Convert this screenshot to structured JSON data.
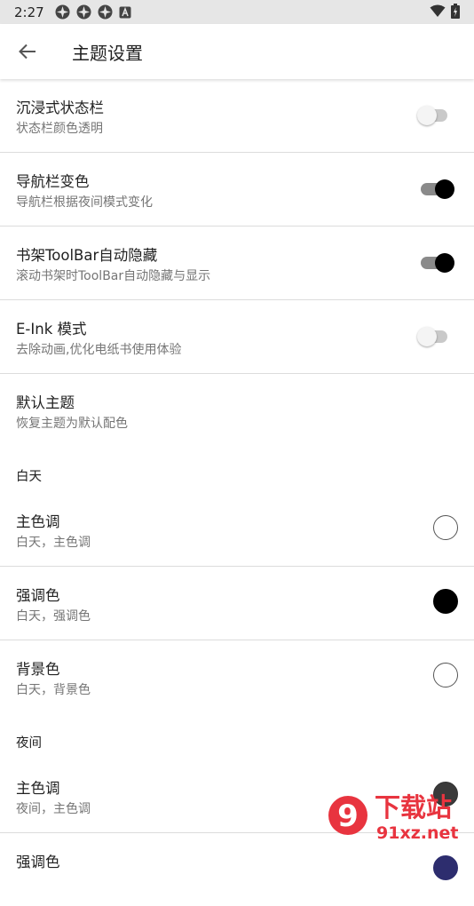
{
  "status_bar": {
    "time": "2:27",
    "icons": [
      "app-notification-icon",
      "app-notification-icon",
      "app-notification-icon",
      "a-notification-icon",
      "wifi-icon",
      "battery-icon"
    ]
  },
  "toolbar": {
    "title": "主题设置",
    "back_icon": "arrow-back-icon"
  },
  "prefs": [
    {
      "title": "沉浸式状态栏",
      "summary": "状态栏颜色透明",
      "switch": "off"
    },
    {
      "title": "导航栏变色",
      "summary": "导航栏根据夜间模式变化",
      "switch": "on"
    },
    {
      "title": "书架ToolBar自动隐藏",
      "summary": "滚动书架时ToolBar自动隐藏与显示",
      "switch": "on"
    },
    {
      "title": "E-Ink 模式",
      "summary": "去除动画,优化电纸书使用体验",
      "switch": "off"
    },
    {
      "title": "默认主题",
      "summary": "恢复主题为默认配色"
    }
  ],
  "day_section": {
    "title": "白天",
    "items": [
      {
        "title": "主色调",
        "summary": "白天，主色调",
        "color": "#ffffff"
      },
      {
        "title": "强调色",
        "summary": "白天，强调色",
        "color": "#000000"
      },
      {
        "title": "背景色",
        "summary": "白天，背景色",
        "color": "#ffffff"
      }
    ]
  },
  "night_section": {
    "title": "夜间",
    "items": [
      {
        "title": "主色调",
        "summary": "夜间，主色调",
        "color": "#3a3a3a"
      },
      {
        "title": "强调色",
        "summary": "",
        "color": "#2d2d6e"
      }
    ]
  },
  "watermark": {
    "main": "下载站",
    "url": "91xz.net",
    "logo": "9"
  }
}
